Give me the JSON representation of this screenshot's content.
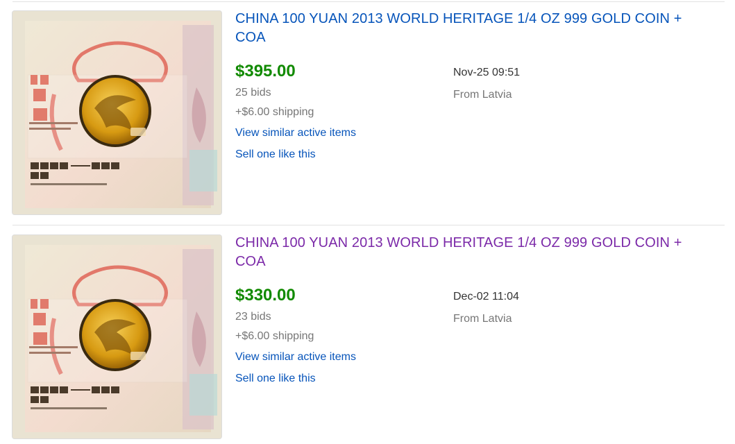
{
  "colors": {
    "title_link": "#0654ba",
    "title_visited": "#7b29a8",
    "price": "#118a00",
    "muted": "#767676"
  },
  "listings": [
    {
      "image_icon": "gold-coin-certificate-photo",
      "title": "CHINA 100 YUAN 2013 WORLD HERITAGE 1/4 OZ 999 GOLD COIN + COA",
      "price": "$395.00",
      "bids": "25 bids",
      "shipping": "+$6.00 shipping",
      "similar_link": "View similar active items",
      "sell_link": "Sell one like this",
      "end_date": "Nov-25 09:51",
      "location": "From Latvia",
      "visited": false
    },
    {
      "image_icon": "gold-coin-certificate-photo",
      "title": "CHINA 100 YUAN 2013 WORLD HERITAGE 1/4 OZ 999 GOLD COIN + COA",
      "price": "$330.00",
      "bids": "23 bids",
      "shipping": "+$6.00 shipping",
      "similar_link": "View similar active items",
      "sell_link": "Sell one like this",
      "end_date": "Dec-02 11:04",
      "location": "From Latvia",
      "visited": true
    }
  ]
}
